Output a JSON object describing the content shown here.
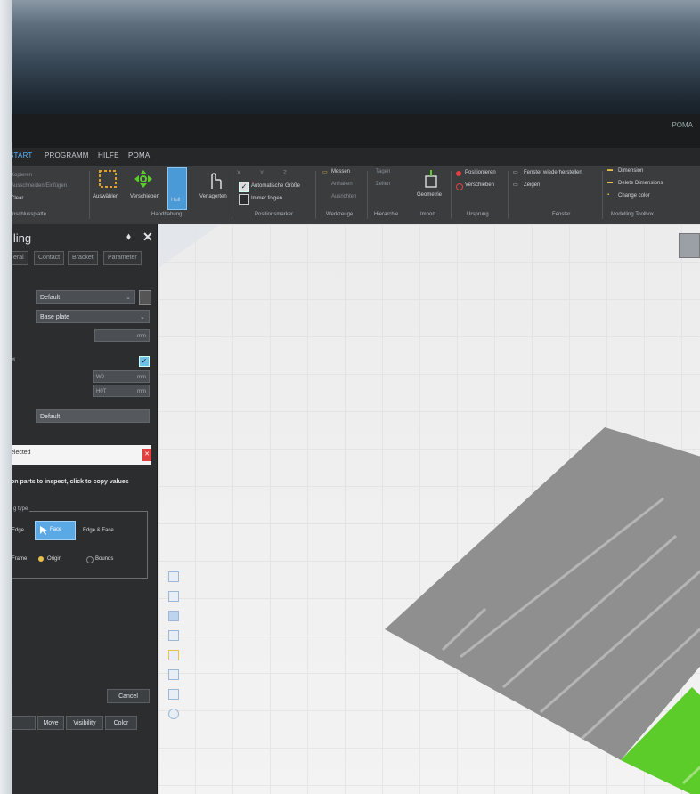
{
  "titlebar": {
    "right_text": "POMA"
  },
  "menu": {
    "items": [
      {
        "label": "START",
        "active": true
      },
      {
        "label": "PROGRAMM",
        "active": false
      },
      {
        "label": "HILFE",
        "active": false
      },
      {
        "label": "POMA",
        "active": false
      }
    ]
  },
  "ribbon": {
    "left_items": [
      "Kopieren",
      "Ausschneiden/Einfügen",
      "Clear"
    ],
    "left_group": "Anschlussplatte",
    "tools": [
      "Auswählen",
      "Verschieben",
      "Hull",
      "Verlagerten"
    ],
    "tools_group": "Handhabung",
    "pos_fields": [
      "X",
      "Y",
      "Z"
    ],
    "checkboxes": [
      "Automatische Größe",
      "Immer folgen"
    ],
    "group_position": "Positionsmarker",
    "measure": [
      "Messen",
      "Anhalten",
      "Ausrichten"
    ],
    "group_werkzeuge": "Werkzeuge",
    "tagging": [
      "Tagen",
      "Zeilen"
    ],
    "group_hierarchie": "Hierarchie",
    "import_label": "Geometrie",
    "group_import": "Import",
    "origin": [
      "Positionieren",
      "Verschieben"
    ],
    "group_ursprung": "Ursprung",
    "fenster": [
      "Fenster wiederherstellen",
      "Zeigen"
    ],
    "group_fenster": "Fenster",
    "toolbox": [
      "Dimension",
      "Delete Dimensions",
      "Change color"
    ],
    "group_toolbox": "Modelling Toolbox"
  },
  "panel": {
    "title": "lling",
    "pin": "⬧",
    "close": "✕",
    "tabs": [
      "eral",
      "Contact",
      "Bracket",
      "Parameter"
    ],
    "dropdown1": "Default",
    "dropdown2": "Base plate",
    "unit_mm": "mm",
    "field_w": "W0",
    "field_h": "H0T",
    "label_checkbox": "ed",
    "label_default_row": "s",
    "default_field": "Default",
    "selection_label": "elected",
    "hint": "on parts to inspect, click to copy values",
    "fieldset_legend": "g type",
    "edge": "Edge",
    "face": "Face",
    "edge_face": "Edge & Face",
    "frame": "Frame",
    "origin": "Origin",
    "bounds": "Bounds",
    "cancel": "Cancel",
    "bottom_tabs": [
      "Move",
      "Visibility",
      "Color"
    ],
    "accent": "#5aa9e6",
    "close_red": "#e04040"
  },
  "viewport": {
    "plate_color": "#8f8f8f",
    "highlight_color": "#5ccc2a",
    "background": "#efefef"
  }
}
